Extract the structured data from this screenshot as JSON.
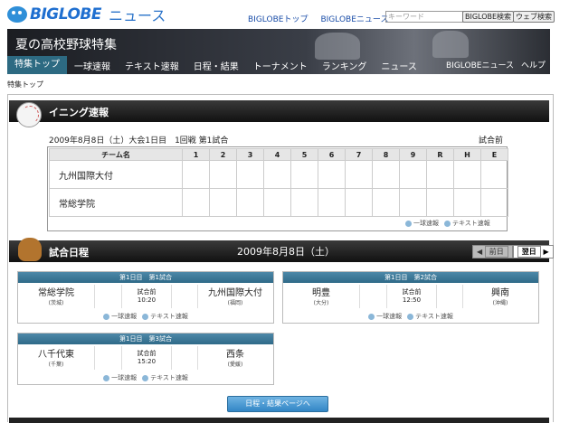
{
  "header": {
    "logo_text": "BIGLOBE",
    "logo_sub": "ニュース",
    "links": [
      "BIGLOBEトップ",
      "BIGLOBEニュース"
    ],
    "search_placeholder": "キーワード",
    "btn_biglobe": "BIGLOBE検索",
    "btn_web": "ウェブ検索"
  },
  "banner": {
    "title": "夏の高校野球特集",
    "nav": [
      "特集トップ",
      "一球速報",
      "テキスト速報",
      "日程・結果",
      "トーナメント",
      "ランキング",
      "ニュース"
    ],
    "nav_right": [
      "BIGLOBEニュース",
      "ヘルプ"
    ]
  },
  "breadcrumb": "特集トップ",
  "inning": {
    "title": "イニング速報",
    "info": "2009年8月8日（土）大会1日目　1回戦 第1試合",
    "status": "試合前",
    "columns": [
      "チーム名",
      "1",
      "2",
      "3",
      "4",
      "5",
      "6",
      "7",
      "8",
      "9",
      "R",
      "H",
      "E"
    ],
    "teams": [
      "九州国際大付",
      "常総学院"
    ],
    "links": [
      "一球速報",
      "テキスト速報"
    ]
  },
  "schedule": {
    "title": "試合日程",
    "date": "2009年8月8日（土）",
    "prev": "前日",
    "next": "翌日",
    "games": [
      {
        "head": "第1日目　第1試合",
        "home": "常総学院",
        "home_pref": "(茨城)",
        "status": "試合前",
        "time": "10:20",
        "away": "九州国際大付",
        "away_pref": "(福岡)"
      },
      {
        "head": "第1日目　第2試合",
        "home": "明豊",
        "home_pref": "(大分)",
        "status": "試合前",
        "time": "12:50",
        "away": "興南",
        "away_pref": "(沖縄)"
      },
      {
        "head": "第1日目　第3試合",
        "home": "八千代東",
        "home_pref": "(千葉)",
        "status": "試合前",
        "time": "15:20",
        "away": "西条",
        "away_pref": "(愛媛)"
      }
    ],
    "links": [
      "一球速報",
      "テキスト速報"
    ],
    "results_button": "日程・結果ページへ"
  },
  "colors": {
    "accent": "#2d6a82",
    "link": "#1a4da8",
    "game_head": "#3a7898"
  }
}
